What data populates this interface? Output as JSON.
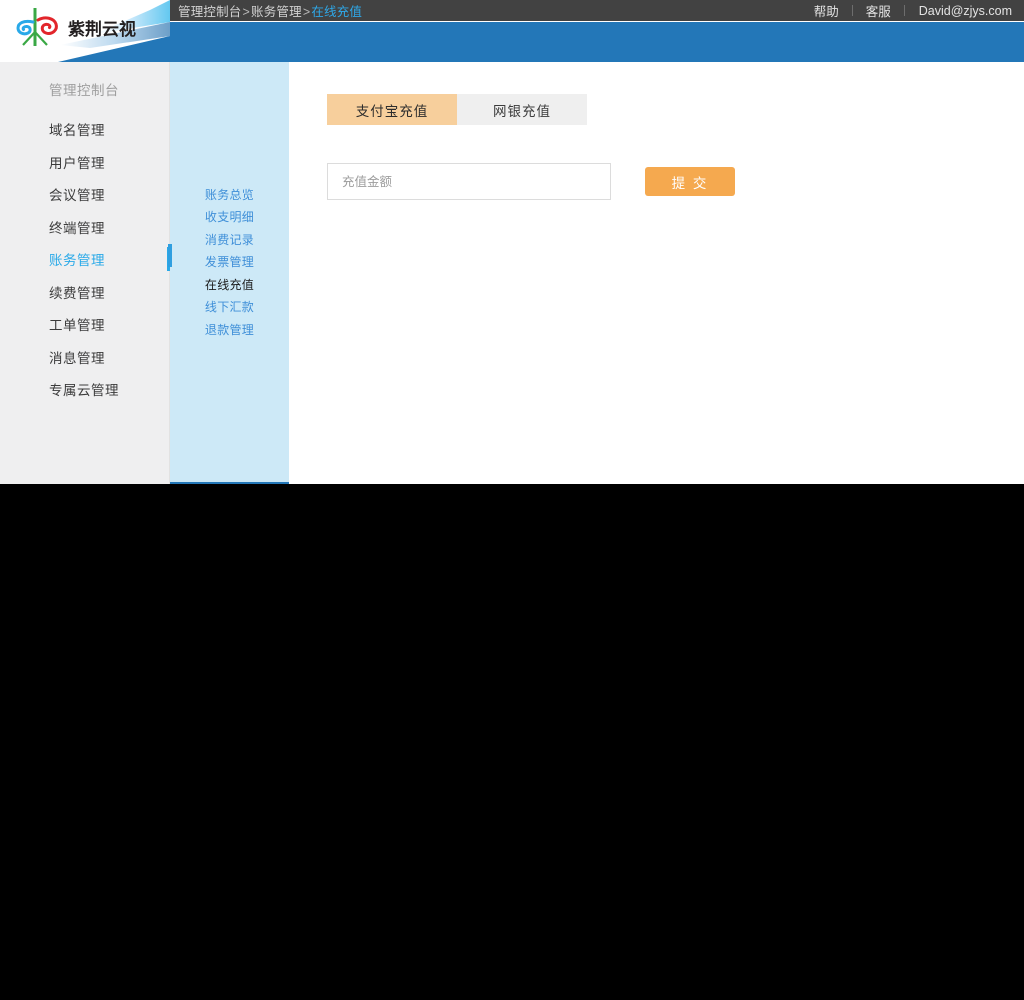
{
  "header": {
    "breadcrumb": {
      "items": [
        "管理控制台",
        "账务管理",
        "在线充值"
      ],
      "separator": ">",
      "item0": "管理控制台",
      "sep0": ">",
      "item1": "账务管理",
      "sep1": ">",
      "current": "在线充值"
    },
    "help_label": "帮助",
    "service_label": "客服",
    "user_account": "David@zjys.com",
    "colors": {
      "topbar_bg": "#424242",
      "banner_bg": "#2377b8",
      "breadcrumb_active": "#2fa8e8"
    }
  },
  "brand": {
    "logo_text": "紫荆云视",
    "logo_icon": "zijing-cloud-video-logo",
    "colors": {
      "green": "#3aa845",
      "cyan": "#29a9e8",
      "red": "#e2252b"
    }
  },
  "sidebar": {
    "title": "管理控制台",
    "items": [
      {
        "label": "域名管理",
        "active": false
      },
      {
        "label": "用户管理",
        "active": false
      },
      {
        "label": "会议管理",
        "active": false
      },
      {
        "label": "终端管理",
        "active": false
      },
      {
        "label": "账务管理",
        "active": true
      },
      {
        "label": "续费管理",
        "active": false
      },
      {
        "label": "工单管理",
        "active": false
      },
      {
        "label": "消息管理",
        "active": false
      },
      {
        "label": "专属云管理",
        "active": false
      }
    ],
    "active_color": "#29a9e8"
  },
  "subnav": {
    "items": [
      {
        "label": "账务总览",
        "active": false
      },
      {
        "label": "收支明细",
        "active": false
      },
      {
        "label": "消费记录",
        "active": false
      },
      {
        "label": "发票管理",
        "active": false
      },
      {
        "label": "在线充值",
        "active": true
      },
      {
        "label": "线下汇款",
        "active": false
      },
      {
        "label": "退款管理",
        "active": false
      }
    ],
    "bg_color": "#cde9f7",
    "link_color": "#3f8fd8"
  },
  "main": {
    "tabs": [
      {
        "label": "支付宝充值",
        "active": true
      },
      {
        "label": "网银充值",
        "active": false
      }
    ],
    "amount_input": {
      "placeholder": "充值金额",
      "value": ""
    },
    "submit_label": "提 交",
    "accent_color": "#f5a94f",
    "tab_active_bg": "#f7cf9c"
  }
}
